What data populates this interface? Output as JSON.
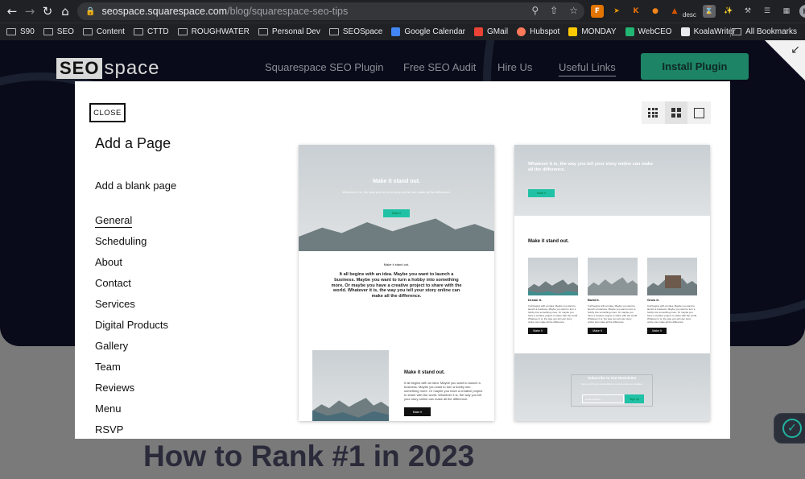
{
  "browser": {
    "url_host": "seospace.squarespace.com",
    "url_path": "/blog/squarespace-seo-tips",
    "ext_desc_label": "desc",
    "avatar_initial": "H",
    "bookmarks": [
      {
        "label": "S90",
        "type": "folder"
      },
      {
        "label": "SEO",
        "type": "folder"
      },
      {
        "label": "Content",
        "type": "folder"
      },
      {
        "label": "CTTD",
        "type": "folder"
      },
      {
        "label": "ROUGHWATER",
        "type": "folder"
      },
      {
        "label": "Personal Dev",
        "type": "folder"
      },
      {
        "label": "SEOSpace",
        "type": "folder"
      },
      {
        "label": "Google Calendar",
        "type": "site",
        "color": "#4285f4"
      },
      {
        "label": "GMail",
        "type": "site",
        "color": "#ea4335"
      },
      {
        "label": "Hubspot",
        "type": "site",
        "color": "#ff7a59"
      },
      {
        "label": "MONDAY",
        "type": "site",
        "color": "#ffcb00"
      },
      {
        "label": "WebCEO",
        "type": "site",
        "color": "#22b573"
      },
      {
        "label": "KoalaWriter",
        "type": "site",
        "color": "#111111"
      }
    ],
    "all_bookmarks": "All Bookmarks"
  },
  "site": {
    "logo_box": "SEO",
    "logo_rest": "space",
    "nav": [
      "Squarespace SEO Plugin",
      "Free SEO Audit",
      "Hire Us",
      "Useful Links"
    ],
    "install_label": "Install Plugin",
    "heading": "How to Rank #1 in 2023",
    "accent": "#1d8466"
  },
  "modal": {
    "close_label": "CLOSE",
    "title": "Add a Page",
    "blank_page": "Add a blank page",
    "categories": [
      "General",
      "Scheduling",
      "About",
      "Contact",
      "Services",
      "Digital Products",
      "Gallery",
      "Team",
      "Reviews",
      "Menu",
      "RSVP"
    ],
    "active_category": "General",
    "template1": {
      "hero_title": "Make it stand out.",
      "hero_sub": "Whatever it is, the way you tell your story online can make all the difference.",
      "hero_button": "Make It",
      "section_label": "Make it stand out.",
      "paragraph": "It all begins with an idea. Maybe you want to launch a business. Maybe you want to turn a hobby into something more. Or maybe you have a creative project to share with the world. Whatever it is, the way you tell your story online can make all the difference.",
      "split_title": "Make it stand out.",
      "split_text": "It all begins with an idea. Maybe you want to launch a business. Maybe you want to turn a hobby into something more. Or maybe you have a creative project to share with the world. Whatever it is, the way you tell your story online can make all the difference.",
      "split_button": "Make It"
    },
    "template2": {
      "hero_title": "Whatever it is, the way you tell your story online can make all the difference.",
      "hero_button": "Make It",
      "section_title": "Make it stand out.",
      "columns": [
        {
          "title": "Dream It.",
          "text": "It all begins with an idea. Maybe you want to launch a business. Maybe you want to turn a hobby into something more. Or maybe you have a creative project to share with the world. Whatever it is, the way you tell your story online can make all the difference.",
          "button": "Make It"
        },
        {
          "title": "Build It.",
          "text": "It all begins with an idea. Maybe you want to launch a business. Maybe you want to turn a hobby into something more. Or maybe you have a creative project to share with the world. Whatever it is, the way you tell your story online can make all the difference.",
          "button": "Make It"
        },
        {
          "title": "Grow It.",
          "text": "It all begins with an idea. Maybe you want to launch a business. Maybe you want to turn a hobby into something more. Or maybe you have a creative project to share with the world. Whatever it is, the way you tell your story online can make all the difference.",
          "button": "Make It"
        }
      ],
      "newsletter_title": "Subscribe to Our Newsletter",
      "newsletter_sub": "Sign up with your email address to receive news and updates.",
      "email_placeholder": "Email Address",
      "signup_button": "Sign up"
    }
  }
}
